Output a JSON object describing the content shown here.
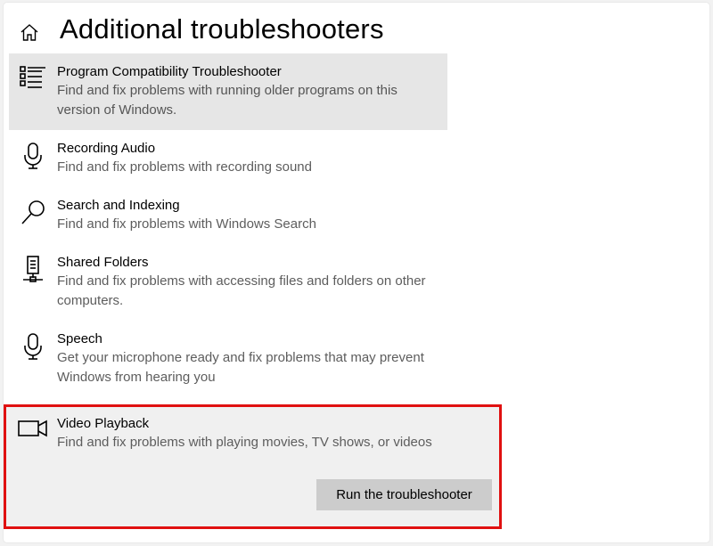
{
  "header": {
    "title": "Additional troubleshooters",
    "home_icon": "home-icon"
  },
  "items": [
    {
      "id": "program-compatibility",
      "title": "Program Compatibility Troubleshooter",
      "description": "Find and fix problems with running older programs on this version of Windows.",
      "icon": "list-icon",
      "state": "hover"
    },
    {
      "id": "recording-audio",
      "title": "Recording Audio",
      "description": "Find and fix problems with recording sound",
      "icon": "microphone-icon"
    },
    {
      "id": "search-indexing",
      "title": "Search and Indexing",
      "description": "Find and fix problems with Windows Search",
      "icon": "search-icon"
    },
    {
      "id": "shared-folders",
      "title": "Shared Folders",
      "description": "Find and fix problems with accessing files and folders on other computers.",
      "icon": "network-drive-icon"
    },
    {
      "id": "speech",
      "title": "Speech",
      "description": "Get your microphone ready and fix problems that may prevent Windows from hearing you",
      "icon": "microphone-icon"
    },
    {
      "id": "video-playback",
      "title": "Video Playback",
      "description": "Find and fix problems with playing movies, TV shows, or videos",
      "icon": "video-camera-icon",
      "state": "selected",
      "button_label": "Run the troubleshooter"
    }
  ],
  "colors": {
    "highlight_outline": "#e01010",
    "hover_bg": "#e6e6e6",
    "button_bg": "#cccccc",
    "description_text": "#5d5d5d"
  }
}
